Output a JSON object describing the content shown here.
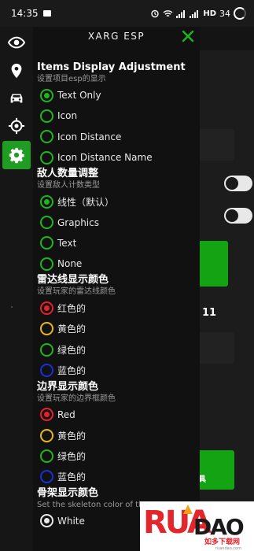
{
  "status_bar": {
    "time": "14:35",
    "network": "HD",
    "battery": "34"
  },
  "sidebar": {
    "items": [
      {
        "name": "visibility",
        "icon": "eye-icon",
        "active": false
      },
      {
        "name": "location",
        "icon": "map-pin-icon",
        "active": false
      },
      {
        "name": "vehicle",
        "icon": "car-icon",
        "active": false
      },
      {
        "name": "aim",
        "icon": "crosshair-icon",
        "active": false
      },
      {
        "name": "settings",
        "icon": "gear-icon",
        "active": true
      }
    ]
  },
  "menu": {
    "title": "XARG ESP",
    "close_icon": "close-icon",
    "sections": [
      {
        "title": "Items Display Adjustment",
        "subtitle": "设置项目esp的显示",
        "options": [
          {
            "label": "Text Only",
            "color": "#1fb51f",
            "selected": true
          },
          {
            "label": "Icon",
            "color": "#1fb51f",
            "selected": false
          },
          {
            "label": "Icon Distance",
            "color": "#1fb51f",
            "selected": false
          },
          {
            "label": "Icon Distance Name",
            "color": "#1fb51f",
            "selected": false
          }
        ]
      },
      {
        "title": "敌人数量调整",
        "subtitle": "设置敌人计数类型",
        "options": [
          {
            "label": "线性（默认）",
            "color": "#1fb51f",
            "selected": true
          },
          {
            "label": "Graphics",
            "color": "#1fb51f",
            "selected": false
          },
          {
            "label": "Text",
            "color": "#1fb51f",
            "selected": false
          },
          {
            "label": "None",
            "color": "#1fb51f",
            "selected": false
          }
        ]
      },
      {
        "title": "雷达线显示颜色",
        "subtitle": "设置玩家的雷达线颜色",
        "options": [
          {
            "label": "红色的",
            "color": "#e8202a",
            "selected": true
          },
          {
            "label": "黄色的",
            "color": "#e8b81e",
            "selected": false
          },
          {
            "label": "绿色的",
            "color": "#1fb51f",
            "selected": false
          },
          {
            "label": "蓝色的",
            "color": "#1a2fd6",
            "selected": false
          }
        ]
      },
      {
        "title": "边界显示颜色",
        "subtitle": "设置玩家的边界框颜色",
        "options": [
          {
            "label": "Red",
            "color": "#e8202a",
            "selected": true
          },
          {
            "label": "黄色的",
            "color": "#e8b81e",
            "selected": false
          },
          {
            "label": "绿色的",
            "color": "#1fb51f",
            "selected": false
          },
          {
            "label": "蓝色的",
            "color": "#1a2fd6",
            "selected": false
          }
        ]
      },
      {
        "title": "骨架显示颜色",
        "subtitle": "Set the skeleton color of the",
        "options": [
          {
            "label": "White",
            "color": "#e8e8e8",
            "selected": true
          }
        ]
      }
    ]
  },
  "background_app": {
    "label_11": "11",
    "label_ju": "具"
  },
  "watermark": {
    "text": "RUANDAO",
    "sub": "如多下载网",
    "url": "ruandao.com"
  },
  "colors": {
    "accent_green": "#1f9c22",
    "panel_bg": "#111111"
  }
}
